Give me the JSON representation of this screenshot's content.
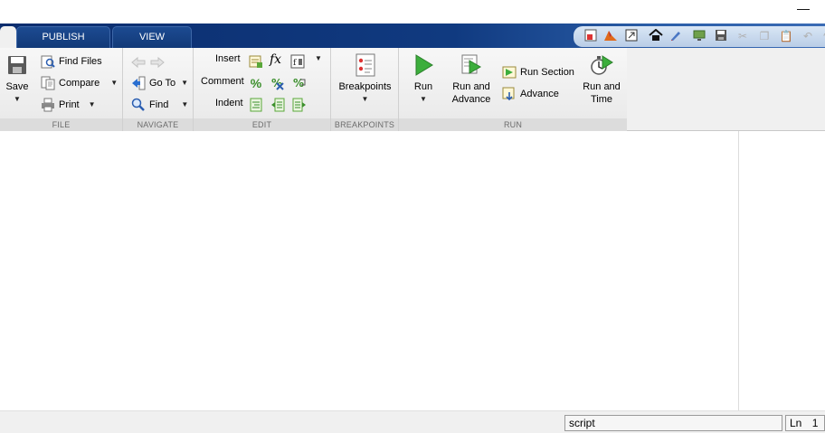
{
  "window": {
    "minimize_glyph": "—"
  },
  "tabs": [
    {
      "label": ""
    },
    {
      "label": "PUBLISH"
    },
    {
      "label": "VIEW"
    }
  ],
  "quick_access": {
    "icons": [
      "layout-icon",
      "simulink-icon",
      "new-window-icon",
      "home-icon",
      "pen-icon",
      "monitor-icon",
      "save-icon",
      "cut-icon",
      "copy-icon",
      "paste-icon",
      "undo-icon",
      "redo-icon"
    ]
  },
  "file": {
    "save_label": "Save",
    "find_files_label": "Find Files",
    "compare_label": "Compare",
    "print_label": "Print",
    "section_label": "FILE"
  },
  "navigate": {
    "goto_label": "Go To",
    "find_label": "Find",
    "section_label": "NAVIGATE"
  },
  "edit": {
    "insert_label": "Insert",
    "comment_label": "Comment",
    "indent_label": "Indent",
    "fx_label": "fx",
    "section_label": "EDIT"
  },
  "breakpoints": {
    "breakpoints_label": "Breakpoints",
    "section_label": "BREAKPOINTS"
  },
  "run": {
    "run_label": "Run",
    "run_and_advance_label": "Run and Advance",
    "run_section_label": "Run Section",
    "advance_label": "Advance",
    "run_and_time_label": "Run and Time",
    "section_label": "RUN"
  },
  "status": {
    "file_type": "script",
    "line_label": "Ln",
    "line_number": "1"
  },
  "colors": {
    "tab_bar": "#103a80",
    "ribbon": "#f0f0f0",
    "section_label_bg": "#dcdcdc",
    "run_green": "#3cae3c"
  }
}
